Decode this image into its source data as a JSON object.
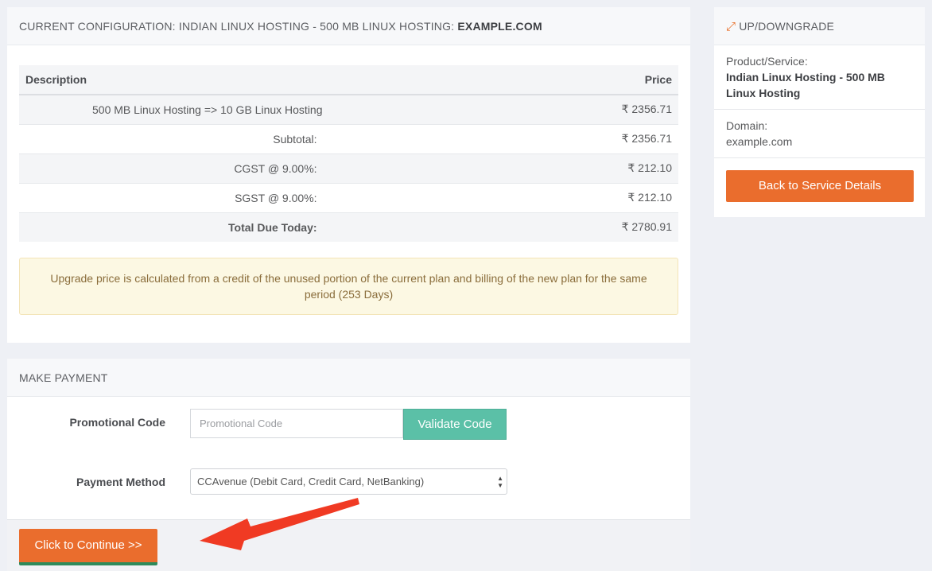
{
  "config": {
    "header_prefix": "CURRENT CONFIGURATION: INDIAN LINUX HOSTING - 500 MB LINUX HOSTING: ",
    "header_domain": "EXAMPLE.COM",
    "table": {
      "col_description": "Description",
      "col_price": "Price",
      "item_description": "500 MB Linux Hosting => 10 GB Linux Hosting",
      "item_price": "₹ 2356.71",
      "subtotal_label": "Subtotal:",
      "subtotal_value": "₹ 2356.71",
      "cgst_label": "CGST @ 9.00%:",
      "cgst_value": "₹ 212.10",
      "sgst_label": "SGST @ 9.00%:",
      "sgst_value": "₹ 212.10",
      "total_label": "Total Due Today:",
      "total_value": "₹ 2780.91"
    },
    "note": "Upgrade price is calculated from a credit of the unused portion of the current plan and billing of the new plan for the same period (253 Days)"
  },
  "payment": {
    "header": "MAKE PAYMENT",
    "promo_label": "Promotional Code",
    "promo_placeholder": "Promotional Code",
    "validate_label": "Validate Code",
    "method_label": "Payment Method",
    "method_selected": "CCAvenue (Debit Card, Credit Card, NetBanking)",
    "continue_label": "Click to Continue >>"
  },
  "sidebar": {
    "header": "UP/DOWNGRADE",
    "product_label": "Product/Service:",
    "product_value": "Indian Linux Hosting - 500 MB Linux Hosting",
    "domain_label": "Domain:",
    "domain_value": "example.com",
    "back_label": "Back to Service Details"
  },
  "colors": {
    "accent_orange": "#ea6d2d",
    "validate_green": "#5bc0a7",
    "annotation_red": "#f03a23"
  },
  "icons": {
    "sidebar_header_icon": "expand-arrows-icon",
    "select_icon": "select-arrows-icon",
    "annotation": "red-arrow-icon"
  }
}
